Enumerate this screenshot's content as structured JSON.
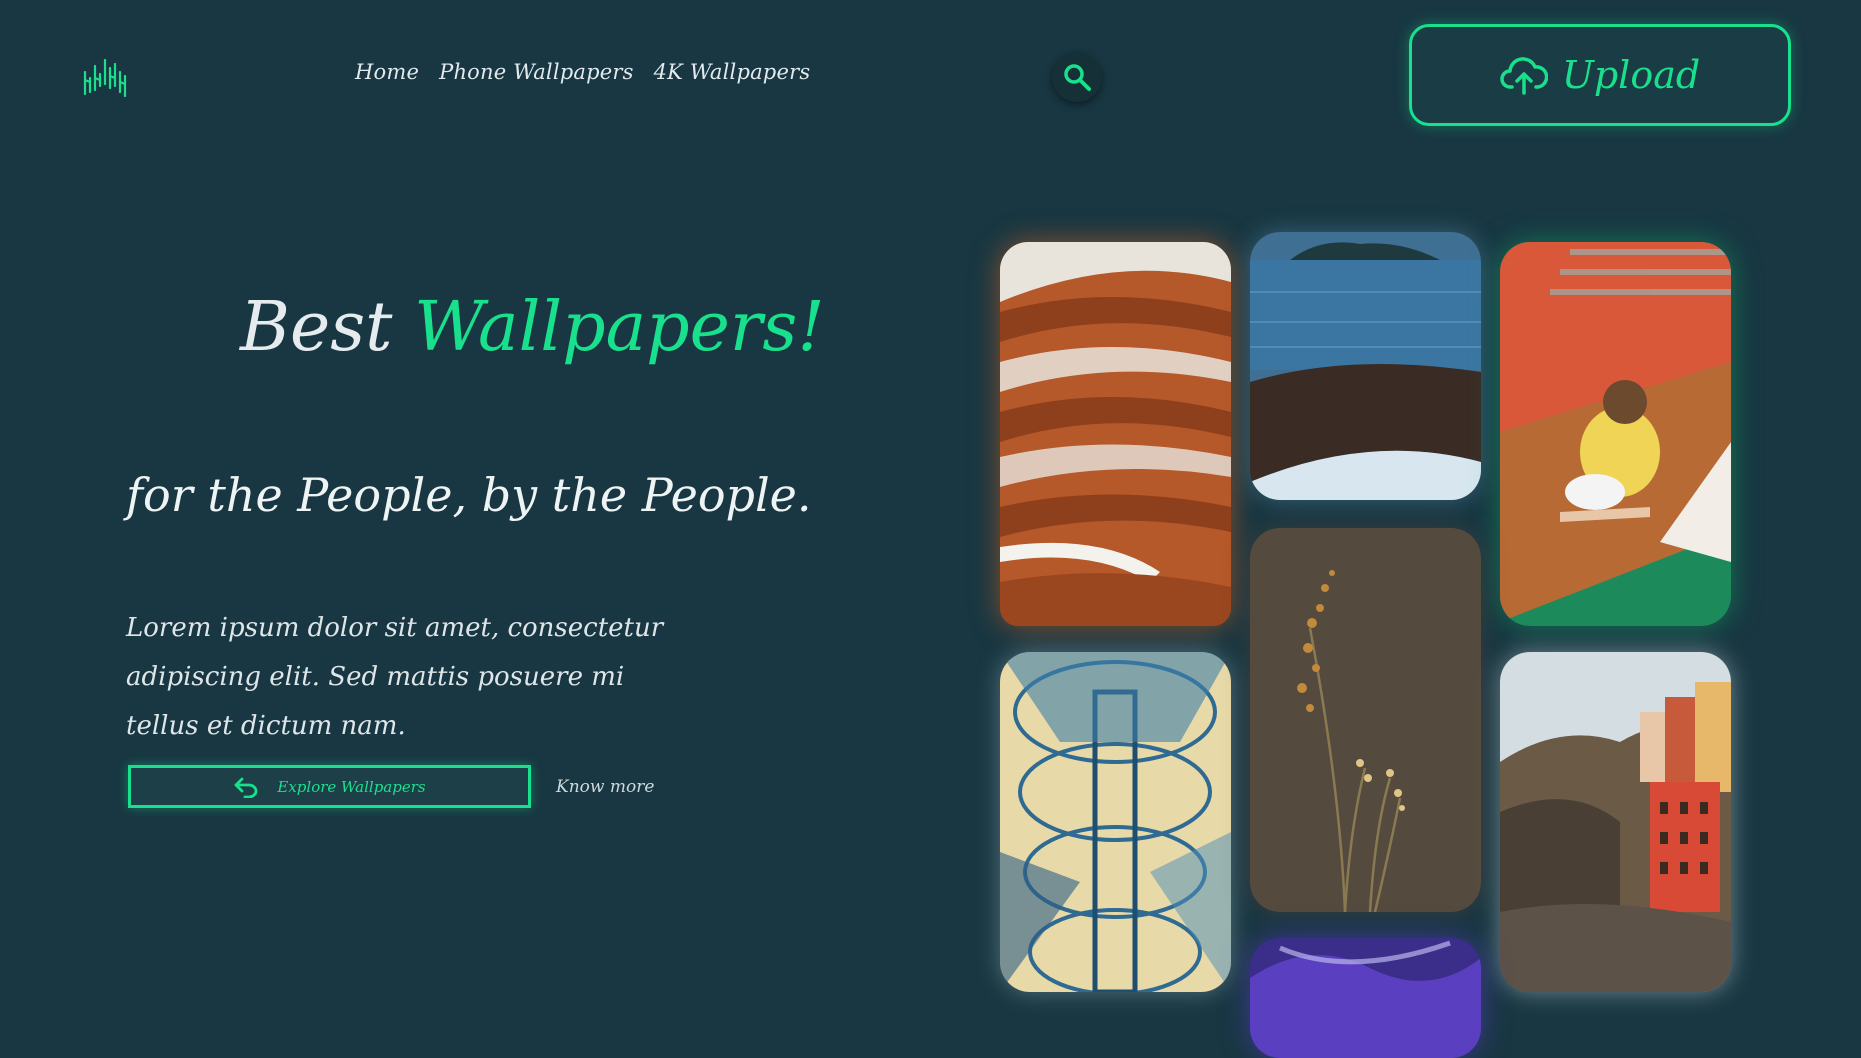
{
  "header": {
    "logo_icon": "equalizer-bars-icon",
    "nav": [
      "Home",
      "Phone Wallpapers",
      "4K Wallpapers"
    ],
    "search_icon": "search-icon",
    "upload_label": "Upload",
    "upload_icon": "cloud-upload-icon"
  },
  "hero": {
    "title_word": "Best",
    "title_accent": "Wallpapers!",
    "subtitle": "for the People, by the People.",
    "description": "Lorem ipsum dolor sit amet, consectetur adipiscing elit. Sed mattis posuere mi tellus et dictum nam.",
    "explore_label": "Explore Wallpapers",
    "explore_icon": "undo-arrow-icon",
    "know_more": "Know more"
  },
  "gallery": {
    "tiles": [
      {
        "name": "orange-architecture-wallpaper",
        "color": "#c4612a"
      },
      {
        "name": "sea-shore-wallpaper",
        "color": "#3a6e96"
      },
      {
        "name": "girl-on-court-wallpaper",
        "color": "#1a8a5a"
      },
      {
        "name": "spiral-staircase-wallpaper",
        "color": "#2f6f9a"
      },
      {
        "name": "dried-flower-wallpaper",
        "color": "#5a4e42"
      },
      {
        "name": "cliffside-village-wallpaper",
        "color": "#c86a4a"
      },
      {
        "name": "purple-abstract-wallpaper",
        "color": "#4a2fa0"
      }
    ]
  },
  "colors": {
    "background": "#183742",
    "accent": "#19e08d",
    "text": "#e8eef0"
  }
}
